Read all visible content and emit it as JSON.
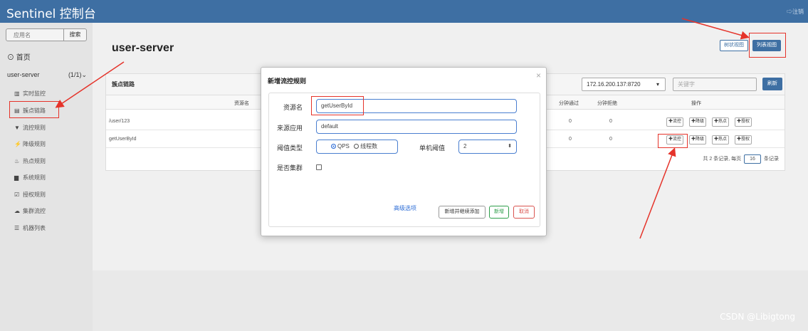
{
  "header": {
    "brand": "Sentinel 控制台",
    "logout": "⇨注销"
  },
  "sidebar": {
    "search_placeholder": "应用名",
    "search_button": "搜索",
    "home": "首页",
    "app_name": "user-server",
    "app_count": "(1/1)",
    "menu": [
      {
        "icon": "chart-icon",
        "glyph": "▥",
        "label": "实时监控"
      },
      {
        "icon": "list-icon",
        "glyph": "▤",
        "label": "簇点链路"
      },
      {
        "icon": "filter-icon",
        "glyph": "▼",
        "label": "流控规则"
      },
      {
        "icon": "bolt-icon",
        "glyph": "⚡",
        "label": "降级规则"
      },
      {
        "icon": "fire-icon",
        "glyph": "♨",
        "label": "热点规则"
      },
      {
        "icon": "briefcase-icon",
        "glyph": "▆",
        "label": "系统规则"
      },
      {
        "icon": "check-icon",
        "glyph": "☑",
        "label": "授权规则"
      },
      {
        "icon": "cloud-icon",
        "glyph": "☁",
        "label": "集群流控"
      },
      {
        "icon": "server-icon",
        "glyph": "☰",
        "label": "机器列表"
      }
    ]
  },
  "main": {
    "page_title": "user-server",
    "view_tree": "树状视图",
    "view_list": "列表视图",
    "panel_title": "簇点链路",
    "ip_select": "172.16.200.137:8720",
    "keyword_placeholder": "关键字",
    "refresh": "刷新",
    "columns": {
      "resource": "资源名",
      "pass_qps": "分钟通过",
      "block_qps": "分钟拒绝",
      "ops": "操作"
    },
    "rows": [
      {
        "resource": "/user/123",
        "pass": "0",
        "block": "0"
      },
      {
        "resource": "getUserById",
        "pass": "0",
        "block": "0"
      }
    ],
    "ops": [
      "✚流控",
      "✚降级",
      "✚热点",
      "✚授权"
    ],
    "pager": {
      "prefix": "共 2 条记录, 每页",
      "size": "16",
      "suffix": "条记录"
    }
  },
  "modal": {
    "title": "新增流控规则",
    "close": "×",
    "resource_label": "资源名",
    "resource_value": "getUserById",
    "origin_label": "来源应用",
    "origin_value": "default",
    "threshold_type_label": "阈值类型",
    "radio_qps": "QPS",
    "radio_threads": "线程数",
    "threshold_label": "单机阈值",
    "threshold_value": "2",
    "cluster_label": "是否集群",
    "advanced": "高级选项",
    "btn_add_continue": "新增并继续添加",
    "btn_add": "新增",
    "btn_cancel": "取消"
  },
  "colors": {
    "header": "#3e6fa3",
    "annotation": "#e5332a",
    "accent": "#2a6bd6"
  },
  "watermark": "CSDN @Libigtong"
}
